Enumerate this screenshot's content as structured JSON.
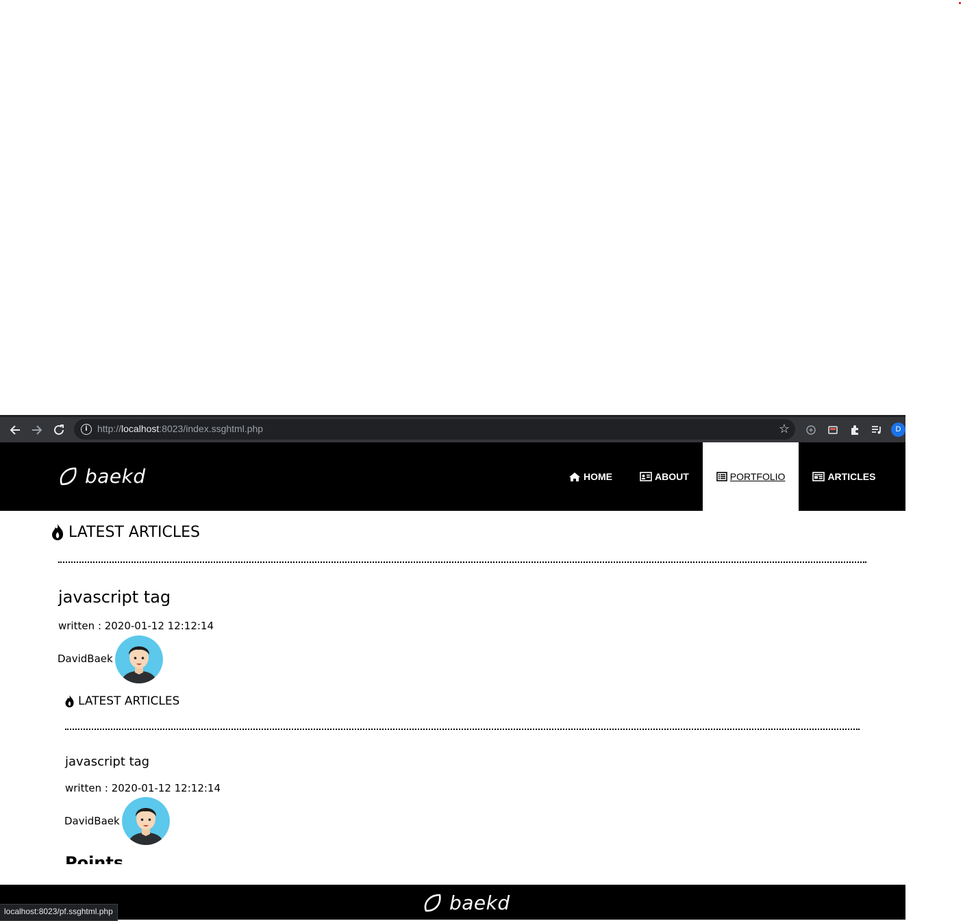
{
  "browser": {
    "url_scheme": "http://",
    "url_host": "localhost",
    "url_rest": ":8023/index.ssghtml.php",
    "profile_initial": "D",
    "status_url": "localhost:8023/pf.ssghtml.php"
  },
  "site": {
    "logo_text": "baekd",
    "nav": [
      {
        "label": "HOME",
        "icon": "home-icon"
      },
      {
        "label": "ABOUT",
        "icon": "id-card-icon"
      },
      {
        "label": "PORTFOLIO",
        "icon": "list-icon",
        "active": true
      },
      {
        "label": "ARTICLES",
        "icon": "newspaper-icon"
      }
    ]
  },
  "section": {
    "title": "LATEST ARTICLES",
    "article_title": "javascript tag",
    "written": "written : 2020-01-12 12:12:14",
    "author": "DavidBaek"
  },
  "nested": {
    "title": "LATEST ARTICLES",
    "article_title": "javascript tag",
    "written": "written : 2020-01-12 12:12:14",
    "author": "DavidBaek",
    "next_heading": "Points"
  },
  "footer": {
    "logo_text": "baekd"
  }
}
